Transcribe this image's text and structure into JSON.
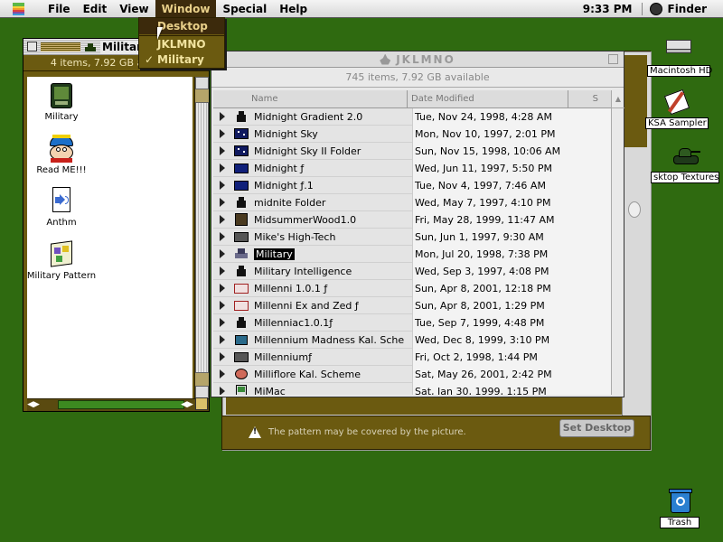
{
  "menubar": {
    "items": [
      "File",
      "Edit",
      "View",
      "Window",
      "Special",
      "Help"
    ],
    "time": "9:33 PM",
    "app": "Finder"
  },
  "window_menu": {
    "items": [
      {
        "label": "Desktop",
        "checked": false,
        "highlighted": true
      },
      {
        "label": "JKLMNO",
        "checked": false,
        "highlighted": false
      },
      {
        "label": "Military",
        "checked": true,
        "highlighted": false
      }
    ],
    "check_mark": "✓"
  },
  "military_window": {
    "title": "Military",
    "info": "4 items, 7.92 GB available",
    "icons": [
      {
        "label": "Military",
        "icon": "military-tank-icon"
      },
      {
        "label": "Read ME!!!",
        "icon": "cartman-face-icon"
      },
      {
        "label": "Anthm",
        "icon": "sound-file-icon"
      },
      {
        "label": "Military Pattern",
        "icon": "pattern-file-icon"
      }
    ]
  },
  "jk_window": {
    "title": "JKLMNO",
    "info": "745 items, 7.92 GB available",
    "columns": {
      "name": "Name",
      "date": "Date Modified",
      "size": "S"
    },
    "rows": [
      {
        "name": "Midnight Gradient 2.0",
        "date": "Tue, Nov 24, 1998, 4:28 AM",
        "icon": "alias-tank-icon",
        "selected": false
      },
      {
        "name": "Midnight Sky",
        "date": "Mon, Nov 10, 1997, 2:01 PM",
        "icon": "night-sky-icon",
        "selected": false
      },
      {
        "name": "Midnight Sky II Folder",
        "date": "Sun, Nov 15, 1998, 10:06 AM",
        "icon": "night-sky-icon",
        "selected": false
      },
      {
        "name": "Midnight ƒ",
        "date": "Wed, Jun 11, 1997, 5:50 PM",
        "icon": "dark-folder-icon",
        "selected": false
      },
      {
        "name": "Midnight ƒ.1",
        "date": "Tue, Nov 4, 1997, 7:46 AM",
        "icon": "dark-folder-icon",
        "selected": false
      },
      {
        "name": "midnite Folder",
        "date": "Wed, May 7, 1997, 4:10 PM",
        "icon": "alias-tank-icon",
        "selected": false
      },
      {
        "name": "MidsummerWood1.0",
        "date": "Fri, May 28, 1999, 11:47 AM",
        "icon": "wood-icon",
        "selected": false
      },
      {
        "name": "Mike's High-Tech",
        "date": "Sun, Jun 1, 1997, 9:30 AM",
        "icon": "gray-folder-icon",
        "selected": false
      },
      {
        "name": "Military",
        "date": "Mon, Jul 20, 1998, 7:38 PM",
        "icon": "military-tank-icon",
        "selected": true
      },
      {
        "name": "Military Intelligence",
        "date": "Wed, Sep 3, 1997, 4:08 PM",
        "icon": "alias-tank-icon",
        "selected": false
      },
      {
        "name": "Millenni 1.0.1 ƒ",
        "date": "Sun, Apr 8, 2001, 12:18 PM",
        "icon": "red-folder-icon",
        "selected": false
      },
      {
        "name": "Millenni Ex and Zed ƒ",
        "date": "Sun, Apr 8, 2001, 1:29 PM",
        "icon": "red-folder-icon",
        "selected": false
      },
      {
        "name": "Millenniac1.0.1ƒ",
        "date": "Tue, Sep 7, 1999, 4:48 PM",
        "icon": "alias-tank-icon",
        "selected": false
      },
      {
        "name": "Millennium Madness Kal. Scheme",
        "date": "Wed, Dec 8, 1999, 3:10 PM",
        "icon": "scheme-icon",
        "selected": false
      },
      {
        "name": "Millenniumƒ",
        "date": "Fri, Oct 2, 1998, 1:44 PM",
        "icon": "gray-folder-icon",
        "selected": false
      },
      {
        "name": "Milliflore Kal. Scheme",
        "date": "Sat, May 26, 2001, 2:42 PM",
        "icon": "flower-icon",
        "selected": false
      },
      {
        "name": "MiMac",
        "date": "Sat, Jan 30, 1999, 1:15 PM",
        "icon": "mac-icon",
        "selected": false
      }
    ]
  },
  "pattern_dialog": {
    "warning": "The pattern may be covered by the picture.",
    "set_button": "Set Desktop"
  },
  "desktop_icons": [
    {
      "label": "Macintosh HD",
      "icon": "hard-disk-icon"
    },
    {
      "label": "KSA Sampler",
      "icon": "document-pen-icon"
    },
    {
      "label": "sktop Textures",
      "icon": "military-tank-icon"
    },
    {
      "label": "Trash",
      "icon": "trash-icon"
    }
  ],
  "colors": {
    "desktop": "#2f6a10",
    "window_olive": "#6b5a10",
    "menu_highlight": "#3c2a0c"
  }
}
